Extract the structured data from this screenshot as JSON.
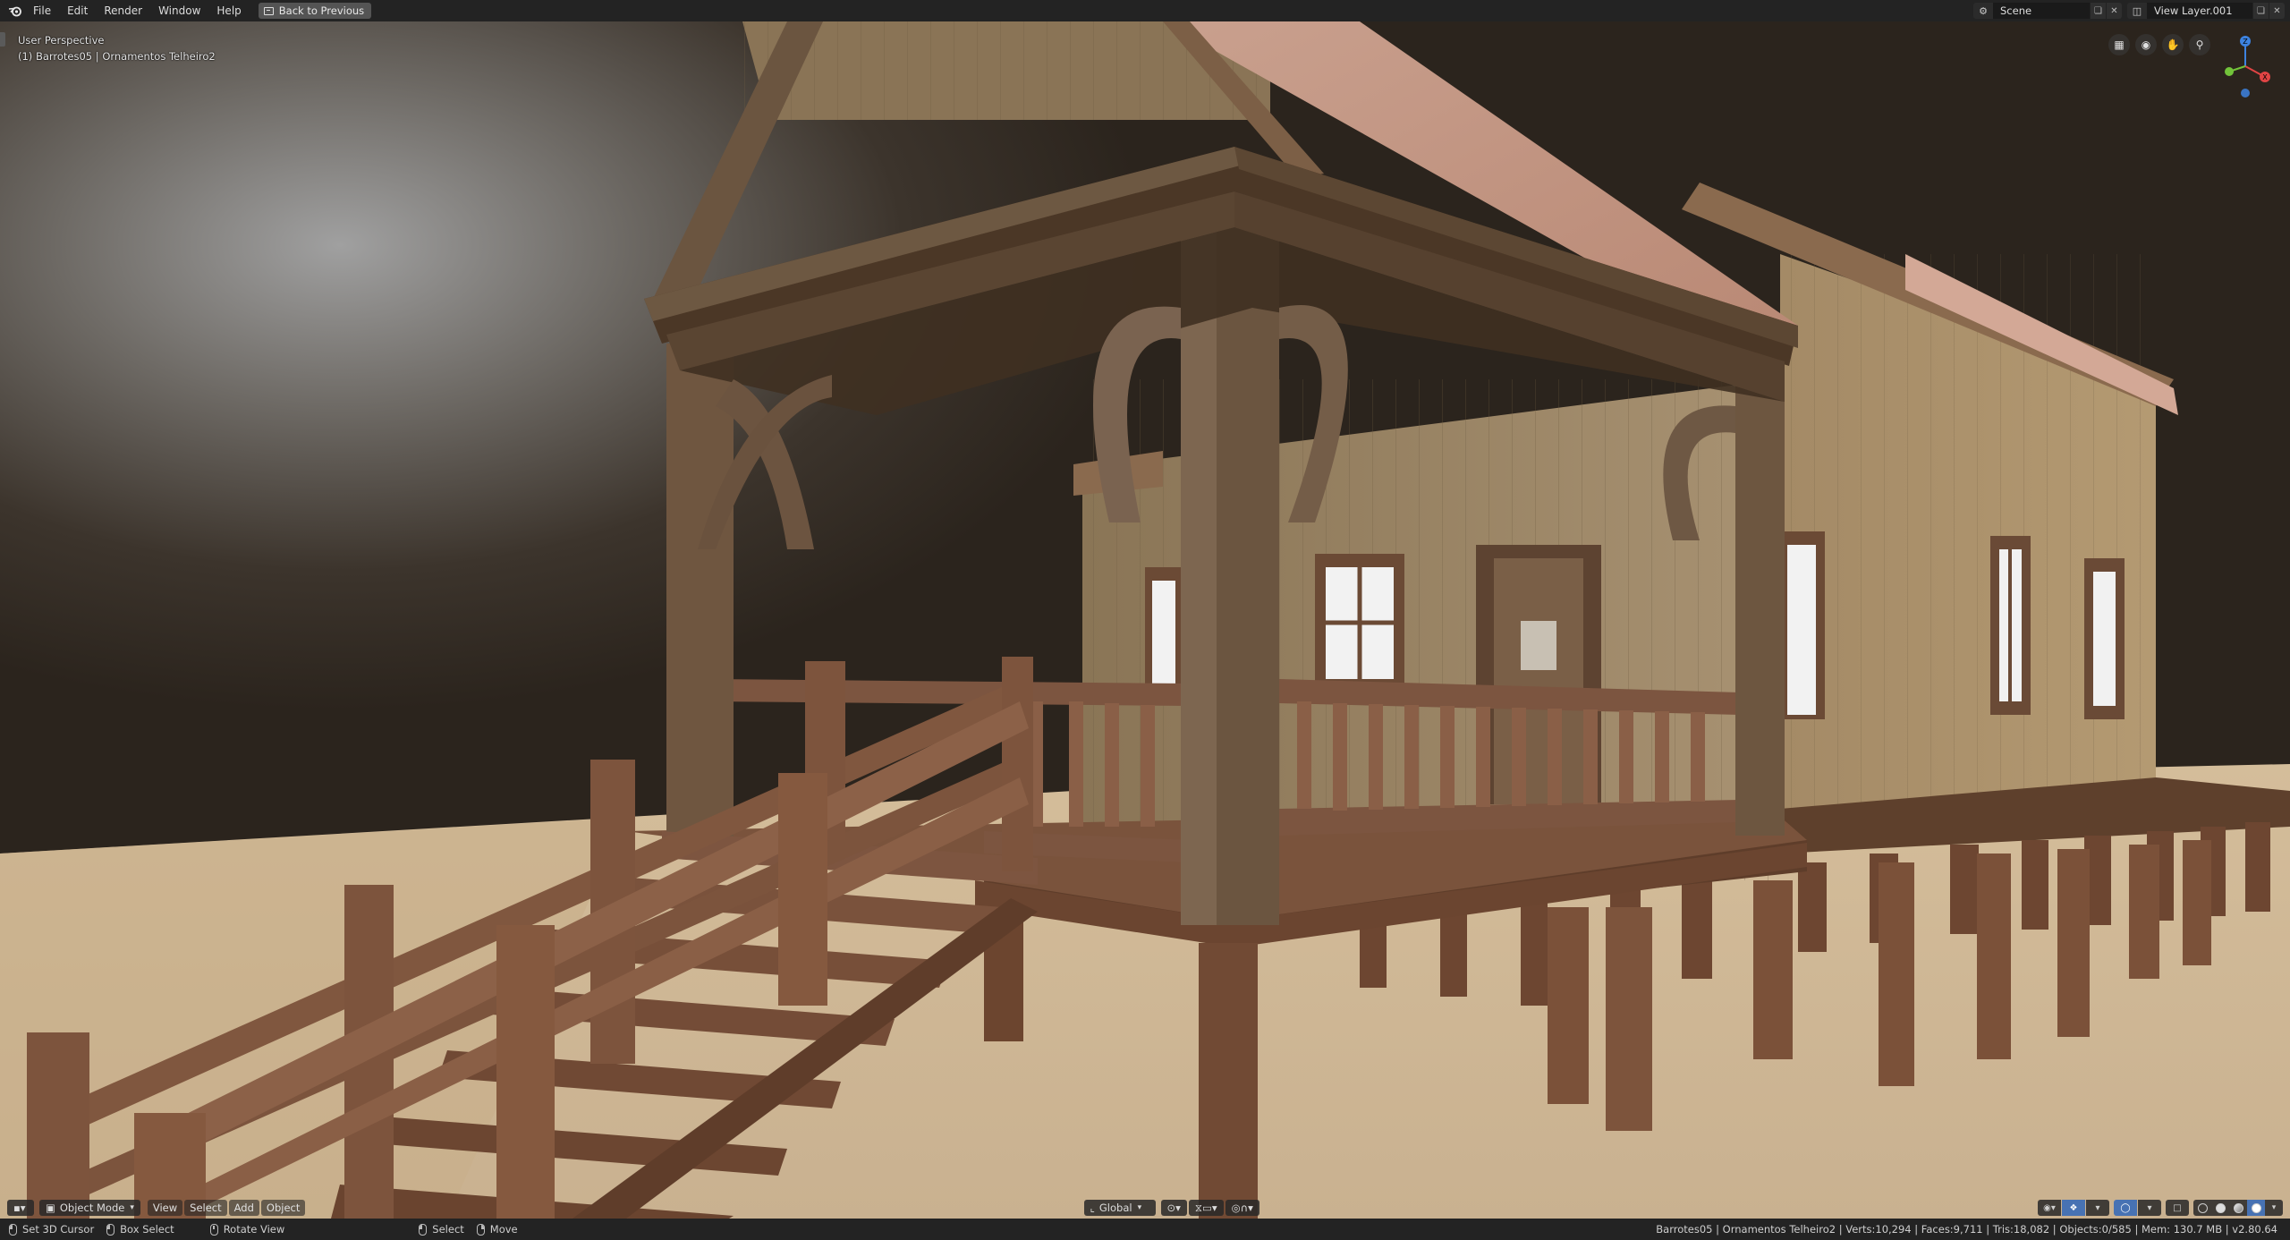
{
  "menubar": {
    "app_icon": "blender-logo-icon",
    "items": [
      "File",
      "Edit",
      "Render",
      "Window",
      "Help"
    ],
    "back_button": "Back to Previous",
    "scene": {
      "icon": "scene-icon",
      "name": "Scene"
    },
    "view_layer": {
      "icon": "view-layer-icon",
      "name": "View Layer.001"
    }
  },
  "viewport": {
    "perspective_label": "User Perspective",
    "object_label": "(1) Barrotes05 | Ornamentos Telheiro2",
    "nav_buttons": [
      "grid-toggle-icon",
      "camera-view-icon",
      "pan-hand-icon",
      "zoom-icon"
    ],
    "gizmo": {
      "axes": [
        "X",
        "Y",
        "Z"
      ],
      "colors": {
        "x": "#e04444",
        "y": "#72c33a",
        "z": "#3d83e0"
      }
    }
  },
  "header": {
    "editor_type_icon": "3d-viewport-icon",
    "mode": "Object Mode",
    "menus": [
      "View",
      "Select",
      "Add",
      "Object"
    ],
    "orientation": "Global",
    "pivot_icon": "pivot-icon",
    "snap_icon": "snap-icon",
    "proportional_icon": "proportional-edit-icon"
  },
  "statusbar": {
    "hints": [
      {
        "icon": "mouse-left-icon",
        "label": "Set 3D Cursor"
      },
      {
        "icon": "mouse-left-icon",
        "label": "Box Select"
      },
      {
        "icon": "mouse-middle-icon",
        "label": "Rotate View"
      },
      {
        "icon": "mouse-left-icon",
        "label": "Select"
      },
      {
        "icon": "mouse-right-icon",
        "label": "Move"
      }
    ],
    "stats": "Barrotes05 | Ornamentos Telheiro2 | Verts:10,294 | Faces:9,711 | Tris:18,082 | Objects:0/585 | Mem: 130.7 MB | v2.80.64"
  },
  "colors": {
    "accent": "#4772b3",
    "wood_dark": "#5a3e2b",
    "wood_light": "#9a8468",
    "roof": "#c89a88",
    "ground": "#cdb89a"
  }
}
